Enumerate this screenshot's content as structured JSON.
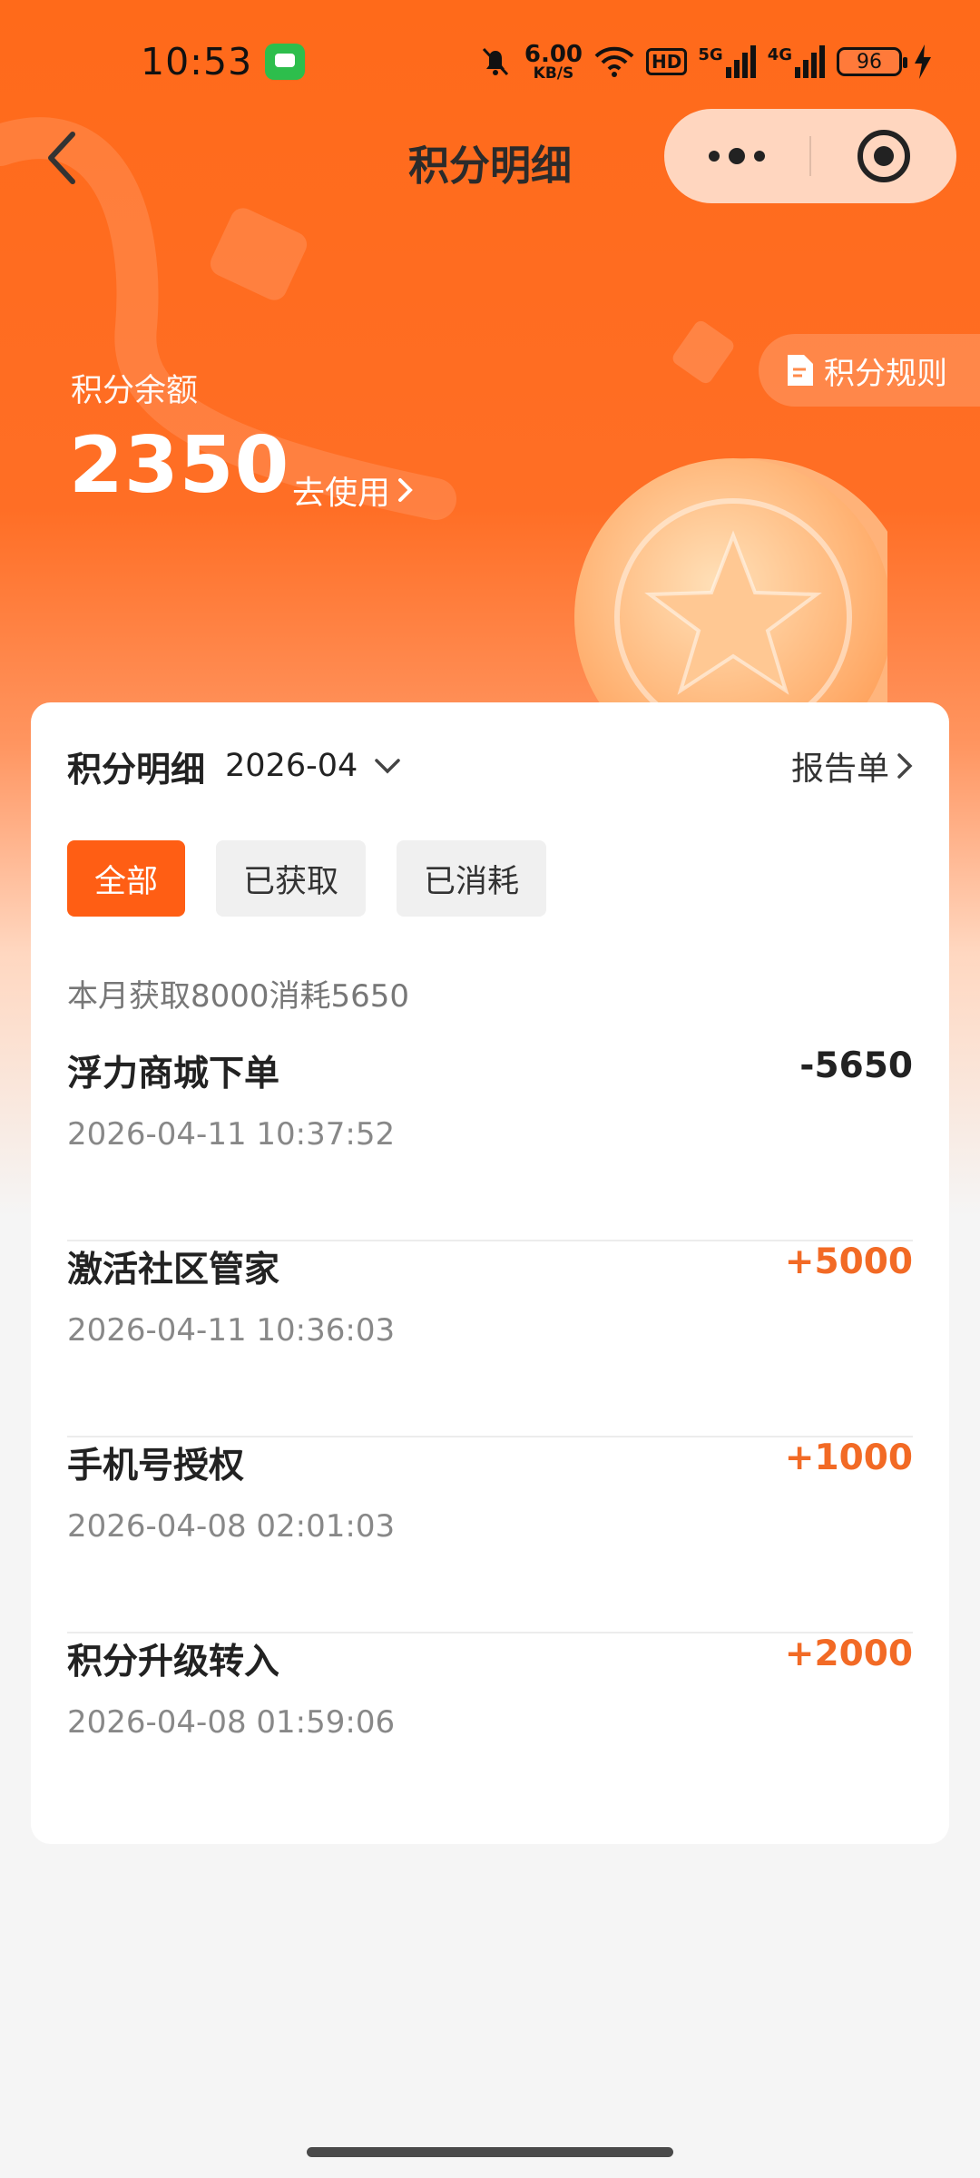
{
  "status_bar": {
    "time": "10:53",
    "net_speed_value": "6.00",
    "net_speed_unit": "KB/S",
    "hd_label": "HD",
    "signal_1": "5G",
    "signal_2": "4G",
    "battery_level": "96"
  },
  "nav": {
    "title": "积分明细"
  },
  "hero": {
    "rules_label": "积分规则",
    "balance_label": "积分余额",
    "balance_value": "2350",
    "use_label": "去使用"
  },
  "card": {
    "title": "积分明细",
    "month": "2026-04",
    "report_label": "报告单",
    "tabs": [
      {
        "label": "全部",
        "active": true
      },
      {
        "label": "已获取",
        "active": false
      },
      {
        "label": "已消耗",
        "active": false
      }
    ],
    "summary": "本月获取8000消耗5650",
    "records": [
      {
        "title": "浮力商城下单",
        "time": "2026-04-11 10:37:52",
        "amount": "-5650",
        "type": "spend"
      },
      {
        "title": "激活社区管家",
        "time": "2026-04-11 10:36:03",
        "amount": "+5000",
        "type": "earn"
      },
      {
        "title": "手机号授权",
        "time": "2026-04-08 02:01:03",
        "amount": "+1000",
        "type": "earn"
      },
      {
        "title": "积分升级转入",
        "time": "2026-04-08 01:59:06",
        "amount": "+2000",
        "type": "earn"
      }
    ]
  },
  "colors": {
    "accent": "#ff5e14",
    "earn": "#f26a25",
    "spend": "#222222"
  }
}
